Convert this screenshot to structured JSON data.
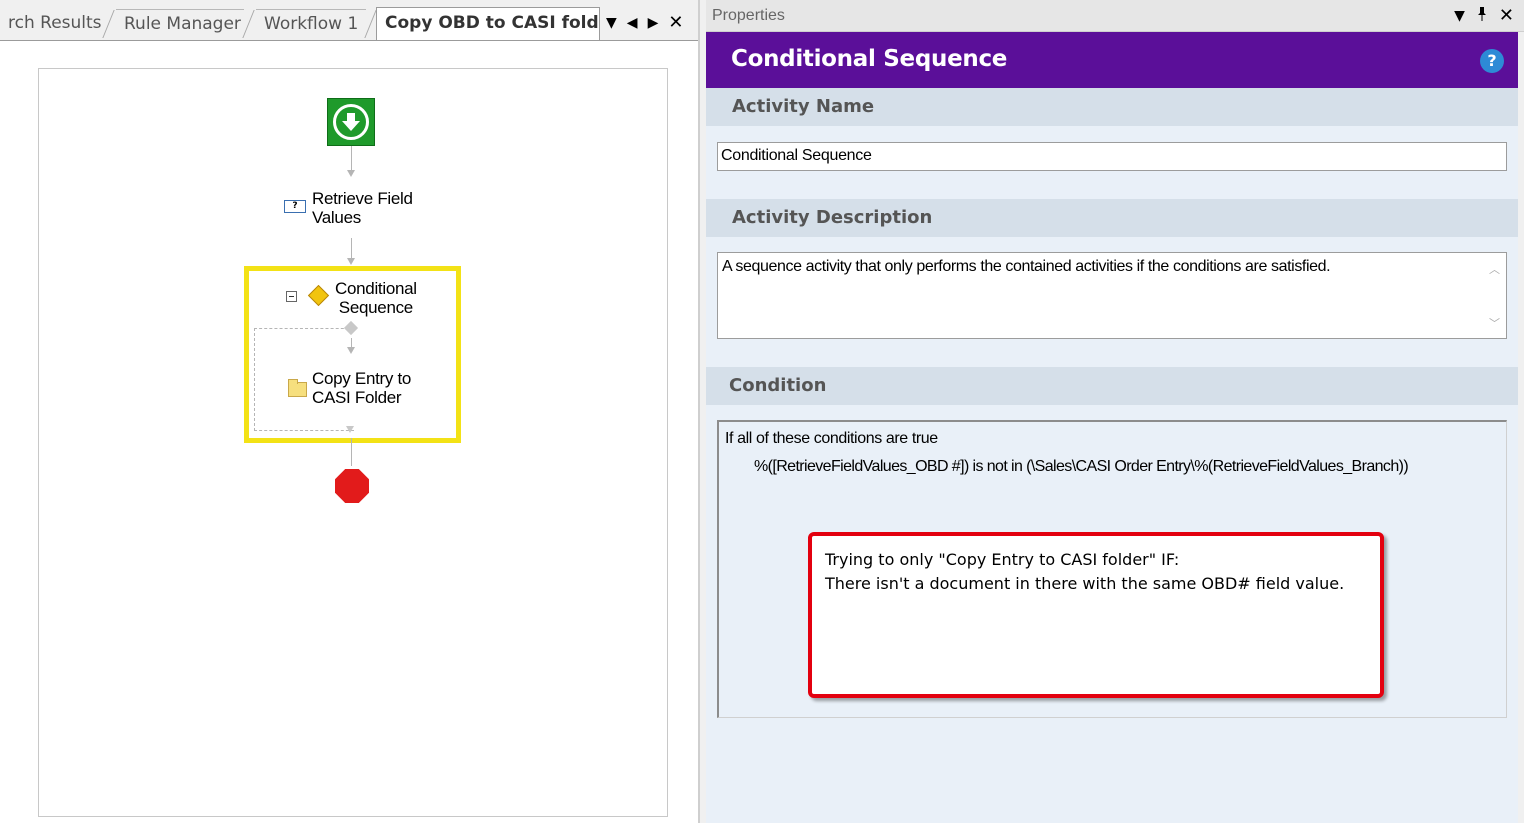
{
  "designer": {
    "tabs": [
      {
        "label": "rch Results"
      },
      {
        "label": "Rule Manager"
      },
      {
        "label": "Workflow 1"
      },
      {
        "label": "Copy OBD to CASI folder"
      }
    ],
    "controls": {
      "menu": "▼",
      "prev": "◀",
      "next": "▶",
      "close": "✕"
    },
    "flow": {
      "start_icon": "start-arrow-icon",
      "retrieve_label": "Retrieve Field\nValues",
      "retrieve_icon_text": "?",
      "conditional_label": "Conditional\nSequence",
      "copy_label": "Copy Entry to\nCASI Folder",
      "stop_icon": "stop-icon"
    }
  },
  "properties": {
    "title": "Properties",
    "controls": {
      "menu": "▼",
      "pin": "📌",
      "close": "✕"
    },
    "header_title": "Conditional Sequence",
    "help_label": "?",
    "activity_name_label": "Activity Name",
    "activity_name_value": "Conditional Sequence",
    "activity_description_label": "Activity Description",
    "activity_description_value": "A sequence activity that only performs the contained activities if the conditions are satisfied.",
    "condition_label": "Condition",
    "condition_line1": "If all of these conditions are true",
    "condition_line2": "%([RetrieveFieldValues_OBD #]) is not in (\\Sales\\CASI Order Entry\\%(RetrieveFieldValues_Branch))",
    "annotation": "Trying to only \"Copy Entry to CASI folder\" IF:\nThere isn't a document in there with the same OBD# field value."
  },
  "colors": {
    "header_purple": "#5b0f99",
    "section_header": "#d5dfe9",
    "highlight_yellow": "#f3e216",
    "annotation_red": "#e3000f",
    "start_green": "#1f9a2b",
    "stop_red": "#e21b1b"
  }
}
